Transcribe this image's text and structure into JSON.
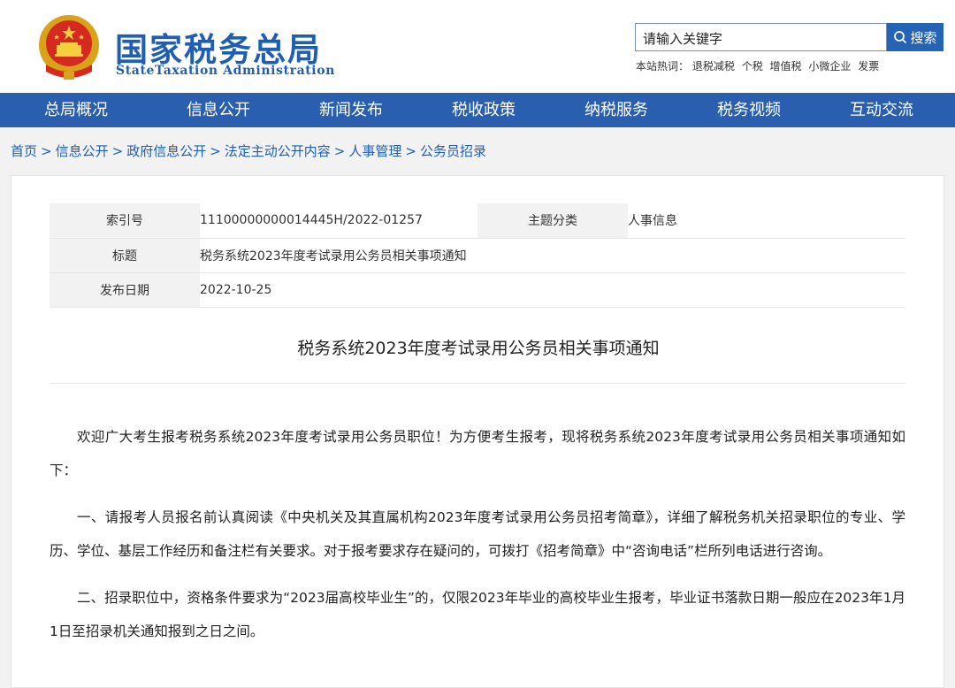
{
  "header": {
    "logo_cn": "国家税务总局",
    "logo_en": "StateTaxation Administration",
    "search_placeholder": "请输入关键字",
    "search_button": "搜索",
    "hotwords_label": "本站热词：",
    "hotwords": [
      "退税减税",
      "个税",
      "增值税",
      "小微企业",
      "发票"
    ]
  },
  "nav": {
    "items": [
      "总局概况",
      "信息公开",
      "新闻发布",
      "税收政策",
      "纳税服务",
      "税务视频",
      "互动交流"
    ]
  },
  "breadcrumb": [
    "首页",
    "信息公开",
    "政府信息公开",
    "法定主动公开内容",
    "人事管理",
    "公务员招录"
  ],
  "meta": {
    "index_label": "索引号",
    "index_value": "11100000000014445H/2022-01257",
    "category_label": "主题分类",
    "category_value": "人事信息",
    "title_label": "标题",
    "title_value": "税务系统2023年度考试录用公务员相关事项通知",
    "date_label": "发布日期",
    "date_value": "2022-10-25"
  },
  "article": {
    "title": "税务系统2023年度考试录用公务员相关事项通知",
    "paragraphs": [
      "欢迎广大考生报考税务系统2023年度考试录用公务员职位！为方便考生报考，现将税务系统2023年度考试录用公务员相关事项通知如下：",
      "一、请报考人员报名前认真阅读《中央机关及其直属机构2023年度考试录用公务员招考简章》，详细了解税务机关招录职位的专业、学历、学位、基层工作经历和备注栏有关要求。对于报考要求存在疑问的，可拨打《招考简章》中“咨询电话”栏所列电话进行咨询。",
      "二、招录职位中，资格条件要求为“2023届高校毕业生”的，仅限2023年毕业的高校毕业生报考，毕业证书落款日期一般应在2023年1月1日至招录机关通知报到之日之间。"
    ]
  },
  "colors": {
    "brand_blue": "#2a5fb0",
    "logo_blue": "#1f5fb3"
  }
}
